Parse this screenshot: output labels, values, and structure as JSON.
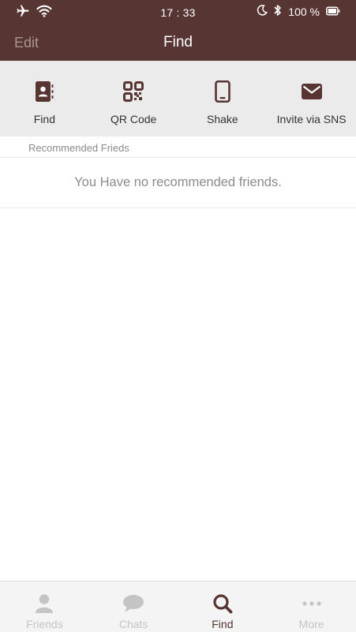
{
  "status_bar": {
    "time": "17 : 33",
    "battery": "100 %"
  },
  "header": {
    "edit_label": "Edit",
    "title": "Find"
  },
  "options": [
    {
      "label": "Find",
      "icon": "address-book-icon"
    },
    {
      "label": "QR Code",
      "icon": "qr-code-icon"
    },
    {
      "label": "Shake",
      "icon": "phone-icon"
    },
    {
      "label": "Invite via SNS",
      "icon": "envelope-icon"
    }
  ],
  "recommended": {
    "section_title": "Recommended Frieds",
    "empty_message": "You Have no recommended friends."
  },
  "tabs": [
    {
      "label": "Friends",
      "icon": "person-icon",
      "active": false
    },
    {
      "label": "Chats",
      "icon": "chat-bubble-icon",
      "active": false
    },
    {
      "label": "Find",
      "icon": "search-icon",
      "active": true
    },
    {
      "label": "More",
      "icon": "more-dots-icon",
      "active": false
    }
  ],
  "colors": {
    "brand": "#563532",
    "options_bg": "#ebebeb",
    "inactive_tab": "#c4c4c4",
    "tabbar_bg": "#f4f4f4"
  }
}
